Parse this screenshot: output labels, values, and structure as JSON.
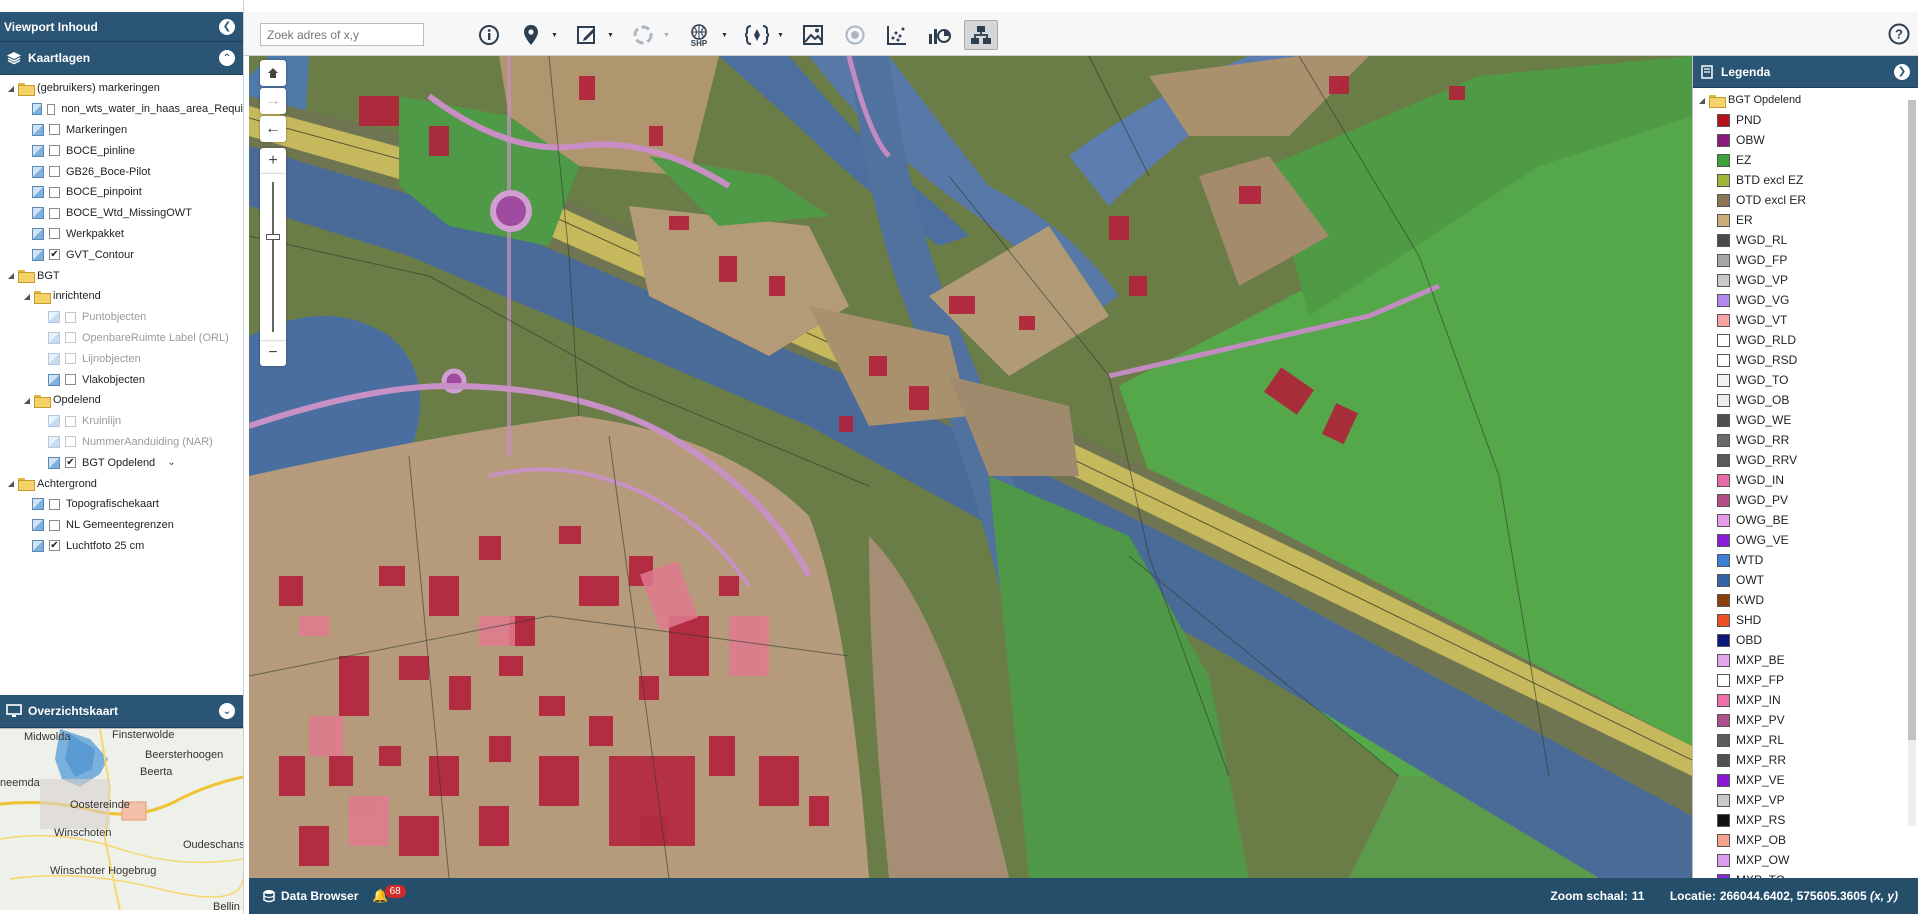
{
  "viewport_panel": {
    "title": "Viewport Inhoud"
  },
  "layers_panel": {
    "title": "Kaartlagen",
    "rows": [
      {
        "label": "(gebruikers) markeringen",
        "level": 0,
        "type": "folder"
      },
      {
        "label": "non_wts_water_in_haas_area_Requi",
        "level": 1,
        "type": "layer",
        "checked": false
      },
      {
        "label": "Markeringen",
        "level": 1,
        "type": "layer",
        "checked": false
      },
      {
        "label": "BOCE_pinline",
        "level": 1,
        "type": "layer",
        "checked": false
      },
      {
        "label": "GB26_Boce-Pilot",
        "level": 1,
        "type": "layer",
        "checked": false
      },
      {
        "label": "BOCE_pinpoint",
        "level": 1,
        "type": "layer",
        "checked": false
      },
      {
        "label": "BOCE_Wtd_MissingOWT",
        "level": 1,
        "type": "layer",
        "checked": false
      },
      {
        "label": "Werkpakket",
        "level": 1,
        "type": "layer",
        "checked": false
      },
      {
        "label": "GVT_Contour",
        "level": 1,
        "type": "layer",
        "checked": true
      },
      {
        "label": "BGT",
        "level": 0,
        "type": "folder"
      },
      {
        "label": "inrichtend",
        "level": 1,
        "type": "folder"
      },
      {
        "label": "Puntobjecten",
        "level": 2,
        "type": "layer",
        "checked": false,
        "disabled": true
      },
      {
        "label": "OpenbareRuimte Label (ORL)",
        "level": 2,
        "type": "layer",
        "checked": false,
        "disabled": true
      },
      {
        "label": "Lijnobjecten",
        "level": 2,
        "type": "layer",
        "checked": false,
        "disabled": true
      },
      {
        "label": "Vlakobjecten",
        "level": 2,
        "type": "layer",
        "checked": false
      },
      {
        "label": "Opdelend",
        "level": 1,
        "type": "folder"
      },
      {
        "label": "Kruinlijn",
        "level": 2,
        "type": "layer",
        "checked": false,
        "disabled": true
      },
      {
        "label": "NummerAanduiding (NAR)",
        "level": 2,
        "type": "layer",
        "checked": false,
        "disabled": true
      },
      {
        "label": "BGT Opdelend",
        "level": 2,
        "type": "layer",
        "checked": true,
        "expand": true
      },
      {
        "label": "Achtergrond",
        "level": 0,
        "type": "folder"
      },
      {
        "label": "Topografischekaart",
        "level": 1,
        "type": "layer",
        "checked": false
      },
      {
        "label": "NL Gemeentegrenzen",
        "level": 1,
        "type": "layer",
        "checked": false
      },
      {
        "label": "Luchtfoto 25 cm",
        "level": 1,
        "type": "layer",
        "checked": true
      }
    ]
  },
  "overview_panel": {
    "title": "Overzichtskaart",
    "places": [
      "Midwolda",
      "Finsterwolde",
      "Beersterhoogen",
      "Beerta",
      "neemda",
      "Oostereinde",
      "Winschoten",
      "Oudeschans",
      "Winschoter Hogebrug",
      "Bellin"
    ]
  },
  "toolbar": {
    "search_placeholder": "Zoek adres of x,y",
    "tools": [
      "info-icon",
      "marker-icon",
      "edit-icon",
      "spinner-icon",
      "shp-icon",
      "fields-icon",
      "image-map-icon",
      "target-icon",
      "scatter-chart-icon",
      "stats-icon",
      "network-icon"
    ],
    "shp_label": "SHP"
  },
  "legend": {
    "title": "Legenda",
    "root": "BGT Opdelend",
    "items": [
      {
        "label": "PND",
        "color": "#b5121b"
      },
      {
        "label": "OBW",
        "color": "#8b1a7c"
      },
      {
        "label": "EZ",
        "color": "#3da23a"
      },
      {
        "label": "BTD excl EZ",
        "color": "#a3b53a"
      },
      {
        "label": "OTD excl ER",
        "color": "#8d7656"
      },
      {
        "label": "ER",
        "color": "#c9ad7a"
      },
      {
        "label": "WGD_RL",
        "color": "#4a4a4a"
      },
      {
        "label": "WGD_FP",
        "color": "#a7a7a7"
      },
      {
        "label": "WGD_VP",
        "color": "#c9c9c9"
      },
      {
        "label": "WGD_VG",
        "color": "#b388f0"
      },
      {
        "label": "WGD_VT",
        "color": "#f7a3a3"
      },
      {
        "label": "WGD_RLD",
        "color": "#ffffff"
      },
      {
        "label": "WGD_RSD",
        "color": "#ffffff"
      },
      {
        "label": "WGD_TO",
        "color": "#f2f2f2"
      },
      {
        "label": "WGD_OB",
        "color": "#eeeeee"
      },
      {
        "label": "WGD_WE",
        "color": "#4f4f4f"
      },
      {
        "label": "WGD_RR",
        "color": "#6a6a6a"
      },
      {
        "label": "WGD_RRV",
        "color": "#595959"
      },
      {
        "label": "WGD_IN",
        "color": "#e86aa7"
      },
      {
        "label": "WGD_PV",
        "color": "#b24d86"
      },
      {
        "label": "OWG_BE",
        "color": "#e59be8"
      },
      {
        "label": "OWG_VE",
        "color": "#8a1ed8"
      },
      {
        "label": "WTD",
        "color": "#3b7fd6"
      },
      {
        "label": "OWT",
        "color": "#3463a6"
      },
      {
        "label": "KWD",
        "color": "#8b3d0f"
      },
      {
        "label": "SHD",
        "color": "#f04e23"
      },
      {
        "label": "OBD",
        "color": "#0b1a7a"
      },
      {
        "label": "MXP_BE",
        "color": "#e3a8ec"
      },
      {
        "label": "MXP_FP",
        "color": "#ffffff"
      },
      {
        "label": "MXP_IN",
        "color": "#ee71ad"
      },
      {
        "label": "MXP_PV",
        "color": "#b04f8e"
      },
      {
        "label": "MXP_RL",
        "color": "#5d5d5d"
      },
      {
        "label": "MXP_RR",
        "color": "#505050"
      },
      {
        "label": "MXP_VE",
        "color": "#8a16d6"
      },
      {
        "label": "MXP_VP",
        "color": "#c9c9c9"
      },
      {
        "label": "MXP_RS",
        "color": "#111111"
      },
      {
        "label": "MXP_OB",
        "color": "#f6a08d"
      },
      {
        "label": "MXP_OW",
        "color": "#d99cf0"
      },
      {
        "label": "MXP_TO",
        "color": "#8a2bd6"
      }
    ]
  },
  "status_bar": {
    "data_browser": "Data Browser",
    "notifications": "68",
    "zoom_label": "Zoom schaal:",
    "zoom_value": "11",
    "location_label": "Locatie:",
    "location_value": "266044.6402, 575605.3605",
    "location_unit": "(x, y)"
  }
}
